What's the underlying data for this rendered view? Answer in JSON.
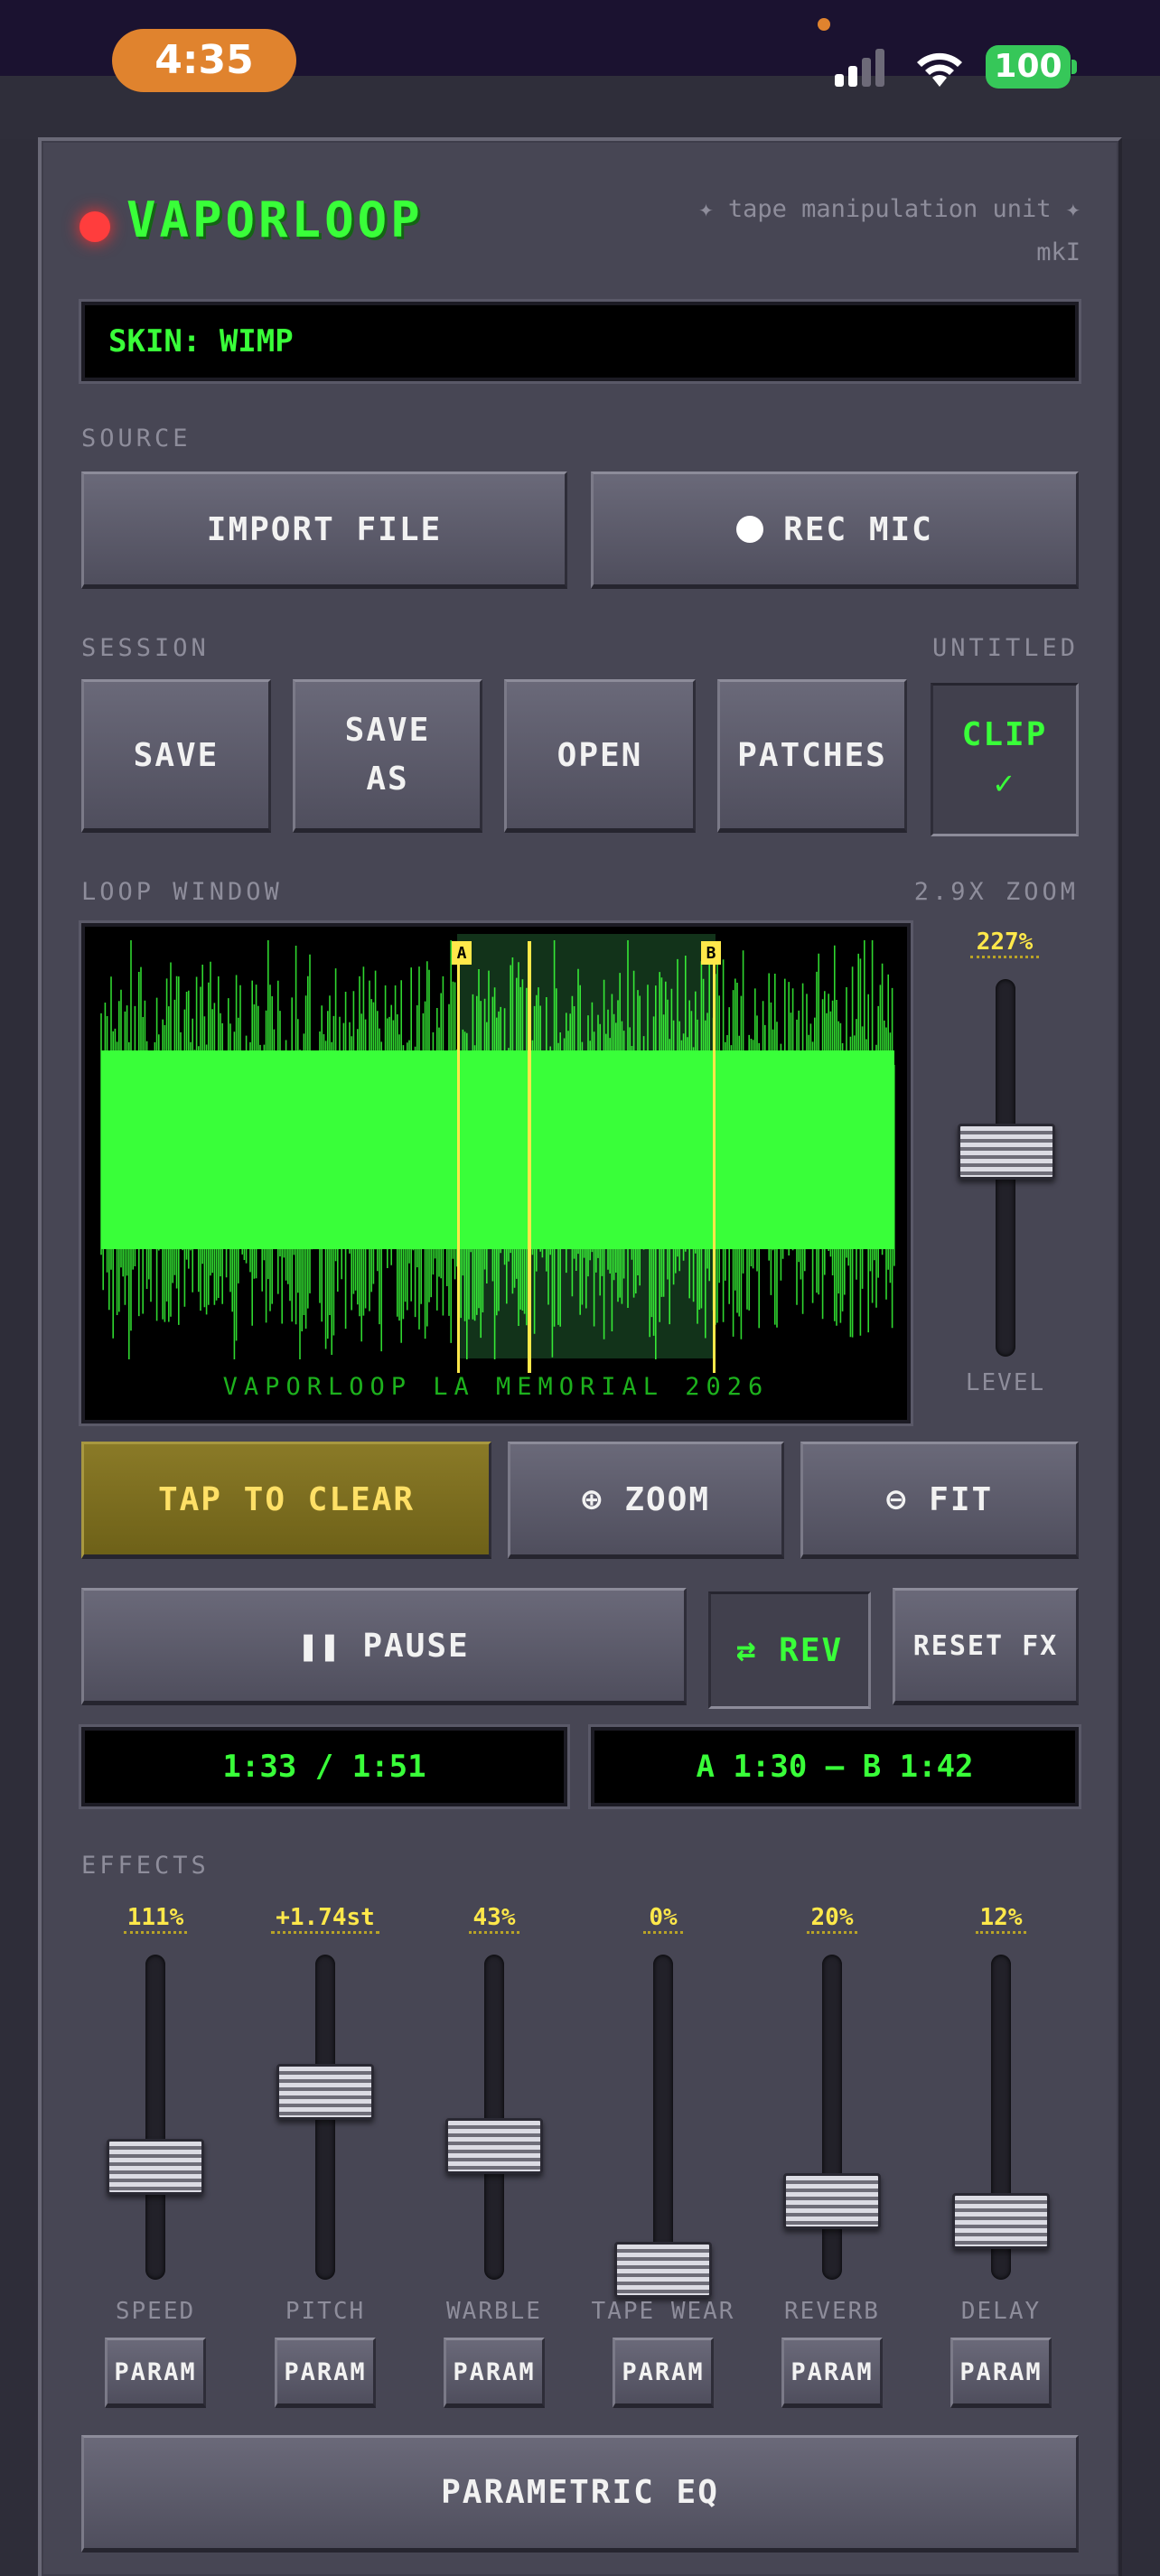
{
  "status_bar": {
    "time": "4:35",
    "battery": "100"
  },
  "header": {
    "app_name": "VAPORLOOP",
    "tagline": "✦ tape manipulation unit ✦\nmkI"
  },
  "skin_display": "SKIN: WIMP",
  "source": {
    "label": "SOURCE",
    "import_label": "IMPORT FILE",
    "rec_label": "REC MIC"
  },
  "session": {
    "label": "SESSION",
    "name": "UNTITLED",
    "buttons": [
      "SAVE",
      "SAVE\nAS",
      "OPEN",
      "PATCHES"
    ],
    "clip_label": "CLIP",
    "clip_check": "✓"
  },
  "loop_window": {
    "label": "LOOP WINDOW",
    "zoom": "2.9X ZOOM",
    "marker_a": "A",
    "marker_b": "B",
    "track_title": "VAPORLOOP LA MEMORIAL 2026",
    "level_value": "227%",
    "level_label": "LEVEL",
    "level_fraction": 0.55
  },
  "controls": {
    "clear_label": "TAP TO CLEAR",
    "zoom_label": "⊕ ZOOM",
    "fit_label": "⊖ FIT",
    "pause_label": "❚❚ PAUSE",
    "rev_label": "⇄ REV",
    "reset_label": "RESET FX"
  },
  "time_display": "1:33 / 1:51",
  "ab_display": "A 1:30 – B 1:42",
  "effects": {
    "label": "EFFECTS",
    "param_label": "PARAM",
    "items": [
      {
        "name": "SPEED",
        "value": "111%",
        "fraction": 0.36
      },
      {
        "name": "PITCH",
        "value": "+1.74st",
        "fraction": 0.62
      },
      {
        "name": "WARBLE",
        "value": "43%",
        "fraction": 0.43
      },
      {
        "name": "TAPE WEAR",
        "value": "0%",
        "fraction": 0.0
      },
      {
        "name": "REVERB",
        "value": "20%",
        "fraction": 0.24
      },
      {
        "name": "DELAY",
        "value": "12%",
        "fraction": 0.17
      }
    ]
  },
  "eq_label": "PARAMETRIC EQ",
  "colors": {
    "lcd_green": "#39ff39",
    "accent_yellow": "#ffe84a",
    "led_red": "#ff3d3d",
    "status_orange": "#e0832e"
  }
}
